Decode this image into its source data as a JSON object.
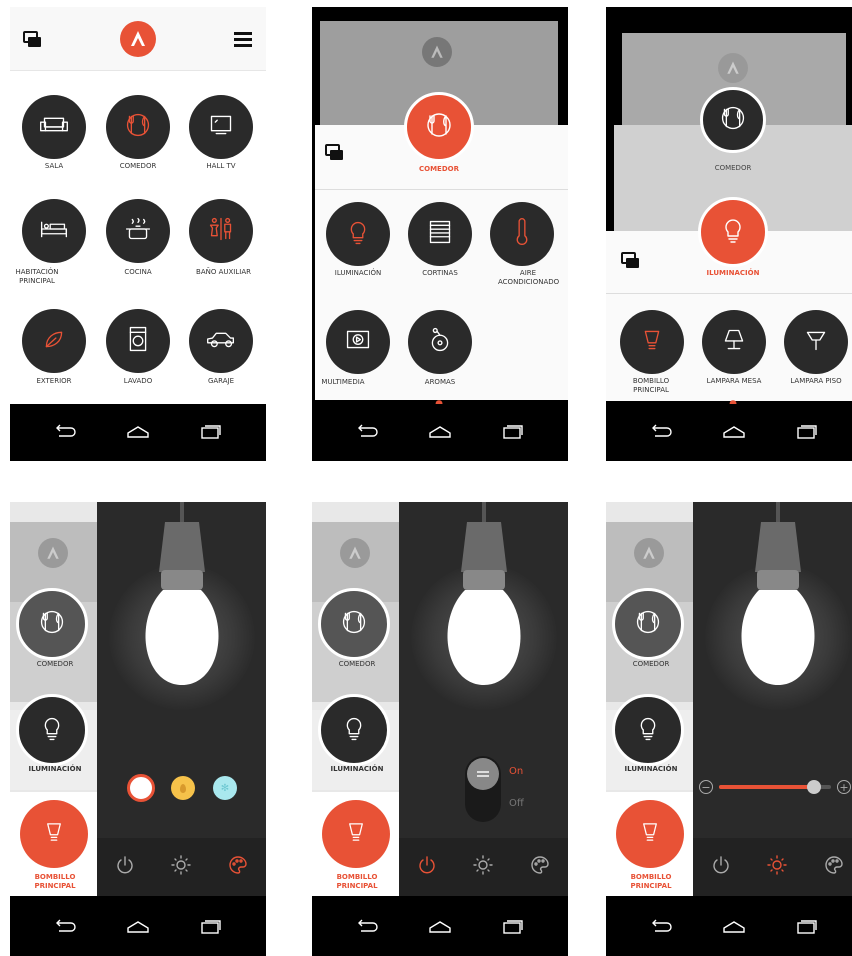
{
  "colors": {
    "accent": "#e85236",
    "dark": "#2a2a2a",
    "pane": "#2b2b2b"
  },
  "screen1": {
    "rooms": [
      {
        "label": "SALA",
        "icon": "sofa-icon"
      },
      {
        "label": "COMEDOR",
        "icon": "dining-icon"
      },
      {
        "label": "HALL TV",
        "icon": "tv-icon"
      },
      {
        "label": "HABITACIÓN PRINCIPAL",
        "icon": "bed-icon"
      },
      {
        "label": "COCINA",
        "icon": "pot-icon"
      },
      {
        "label": "BAÑO AUXILIAR",
        "icon": "restroom-icon"
      },
      {
        "label": "EXTERIOR",
        "icon": "leaf-icon"
      },
      {
        "label": "LAVADO",
        "icon": "washer-icon"
      },
      {
        "label": "GARAJE",
        "icon": "car-icon"
      }
    ],
    "page_dots": "● ○"
  },
  "screen2": {
    "title": "COMEDOR",
    "items": [
      {
        "label": "ILUMINACIÓN",
        "icon": "bulb-icon"
      },
      {
        "label": "CORTINAS",
        "icon": "blinds-icon"
      },
      {
        "label": "AIRE ACONDICIONADO",
        "icon": "thermometer-icon"
      },
      {
        "label": "MULTIMEDIA",
        "icon": "media-icon"
      },
      {
        "label": "AROMAS",
        "icon": "aroma-icon"
      }
    ],
    "page_dot": "●"
  },
  "screen3": {
    "back_title": "COMEDOR",
    "title": "ILUMINACIÓN",
    "items": [
      {
        "label": "BOMBILLO PRINCIPAL",
        "icon": "bulb-small-icon"
      },
      {
        "label": "LAMPARA MESA",
        "icon": "table-lamp-icon"
      },
      {
        "label": "LAMPARA PISO",
        "icon": "floor-lamp-icon"
      }
    ],
    "page_dot": "●"
  },
  "detail": {
    "room": "COMEDOR",
    "category": "ILUMINACIÓN",
    "device_line1": "BOMBILLO",
    "device_line2": "PRINCIPAL",
    "toggle_on": "On",
    "toggle_off": "Off",
    "brightness": 0.85,
    "color_options": [
      "#ffffff",
      "#f6c24a",
      "#a9e8ee"
    ]
  }
}
